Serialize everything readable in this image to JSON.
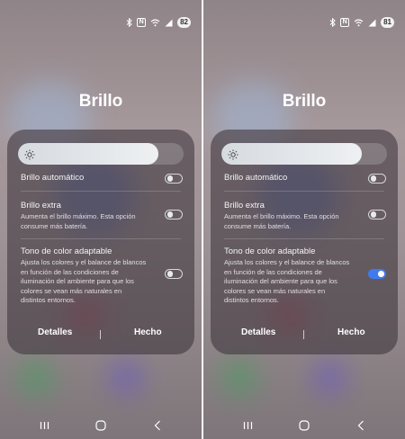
{
  "screens": [
    {
      "status": {
        "battery": "82",
        "nfc": "N"
      },
      "title": "Brillo",
      "brightness_level": 0.85,
      "settings": [
        {
          "title": "Brillo automático",
          "desc": "",
          "on": false
        },
        {
          "title": "Brillo extra",
          "desc": "Aumenta el brillo máximo. Esta opción consume más batería.",
          "on": false
        },
        {
          "title": "Tono de color adaptable",
          "desc": "Ajusta los colores y el balance de blancos en función de las condiciones de iluminación del ambiente para que los colores se vean más naturales en distintos entornos.",
          "on": false
        }
      ],
      "footer": {
        "details": "Detalles",
        "done": "Hecho"
      }
    },
    {
      "status": {
        "battery": "81",
        "nfc": "N"
      },
      "title": "Brillo",
      "brightness_level": 0.85,
      "settings": [
        {
          "title": "Brillo automático",
          "desc": "",
          "on": false
        },
        {
          "title": "Brillo extra",
          "desc": "Aumenta el brillo máximo. Esta opción consume más batería.",
          "on": false
        },
        {
          "title": "Tono de color adaptable",
          "desc": "Ajusta los colores y el balance de blancos en función de las condiciones de iluminación del ambiente para que los colores se vean más naturales en distintos entornos.",
          "on": true
        }
      ],
      "footer": {
        "details": "Detalles",
        "done": "Hecho"
      }
    }
  ],
  "icons": [
    "bluetooth-icon",
    "nfc-icon",
    "wifi-icon",
    "signal-icon",
    "sun-icon",
    "recents-icon",
    "home-icon",
    "back-icon"
  ],
  "colors": {
    "toggle_on": "#3f7af0",
    "panel": "#3c343a"
  }
}
